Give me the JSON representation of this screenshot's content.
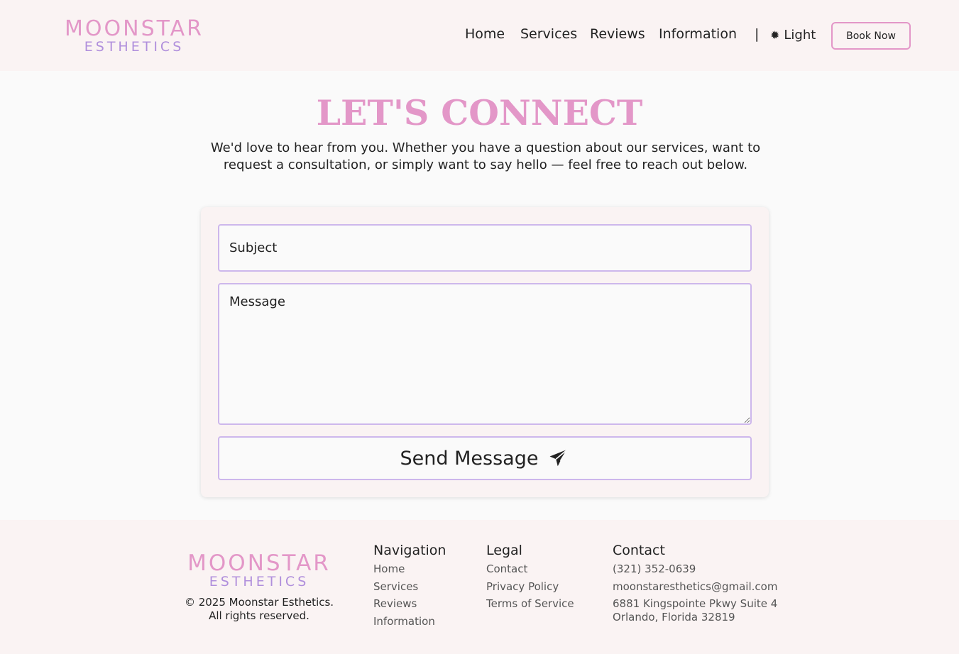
{
  "brand": {
    "name": "MOONSTAR",
    "sub": "ESTHETICS"
  },
  "nav": {
    "items": [
      "Home",
      "Services",
      "Reviews",
      "Information"
    ],
    "separator": "|",
    "theme_label": "Light",
    "book_label": "Book Now"
  },
  "hero": {
    "title": "LET'S CONNECT",
    "intro": "We'd love to hear from you. Whether you have a question about our services, want to request a consultation, or simply want to say hello — feel free to reach out below."
  },
  "form": {
    "subject_placeholder": "Subject",
    "message_placeholder": "Message",
    "send_label": "Send Message"
  },
  "footer": {
    "copyright_line1": "© 2025 Moonstar Esthetics.",
    "copyright_line2": "All rights reserved.",
    "navigation": {
      "heading": "Navigation",
      "links": [
        "Home",
        "Services",
        "Reviews",
        "Information"
      ]
    },
    "legal": {
      "heading": "Legal",
      "links": [
        "Contact",
        "Privacy Policy",
        "Terms of Service"
      ]
    },
    "contact": {
      "heading": "Contact",
      "phone": "(321) 352-0639",
      "email": "moonstaresthetics@gmail.com",
      "address_line1": "6881 Kingspointe Pkwy Suite 4",
      "address_line2": "Orlando, Florida 32819"
    }
  },
  "colors": {
    "accent_pink": "#e397c8",
    "accent_purple": "#b08fdc",
    "border_lavender": "#cdb7ec",
    "panel_bg": "#faf3f3"
  },
  "icons": {
    "theme": "sun-icon",
    "send": "paper-plane-icon"
  }
}
